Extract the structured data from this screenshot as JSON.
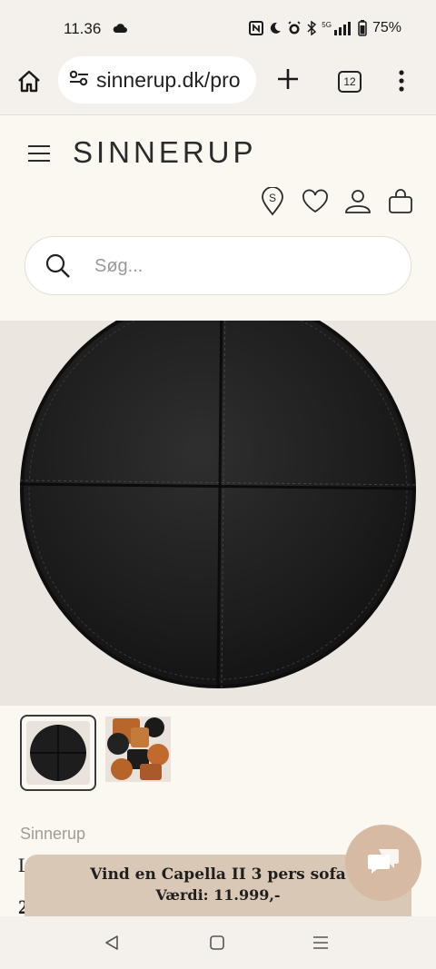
{
  "status_bar": {
    "time": "11.36",
    "cloud_icon": "cloud-icon",
    "network": "5G",
    "battery": "75%"
  },
  "browser": {
    "url": "sinnerup.dk/pro",
    "tab_count": "12"
  },
  "site": {
    "brand": "SINNERUP",
    "search_placeholder": "Søg..."
  },
  "product": {
    "vendor": "Sinnerup",
    "title_peek": "L",
    "price_peek": "2"
  },
  "promo": {
    "line1": "Vind en Capella II 3 pers sofa",
    "line2": "Værdi: 11.999,-"
  },
  "colors": {
    "accent": "#d6baa3",
    "promo_bg": "#d9c8b6",
    "page_bg": "#fbf8f2"
  }
}
